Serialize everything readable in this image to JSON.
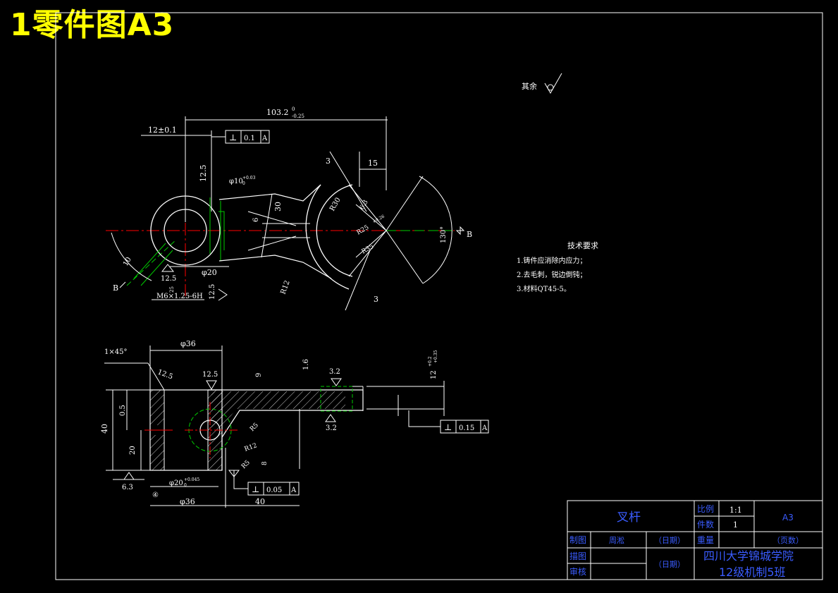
{
  "page_title": "1零件图A3",
  "roughness_note": "其余",
  "tech_requirements": {
    "title": "技术要求",
    "items": [
      "1.铸件应消除内应力；",
      "2.去毛刺，锐边倒钝；",
      "3.材料QT45-5。"
    ]
  },
  "dims": {
    "d103": "103.2",
    "d103_tol": "0",
    "d103_tol2": "-0.25",
    "d12": "12±0.1",
    "perp_sym": "⊥",
    "tol_01": "0.1",
    "datum_A": "A",
    "d15": "15",
    "d3_top": "3",
    "d3_bot": "3",
    "d12_5_top": "12.5",
    "phi10": "φ10",
    "phi10_tol": "+0.03",
    "phi10_tol2": "0",
    "d30": "30",
    "d6": "6",
    "R30": "R30",
    "R25": "R25",
    "R35": "R35",
    "R12": "R12",
    "d6_3": "6.3",
    "r_tol": "+0.26",
    "angle130": "130°",
    "section_B_right": "B",
    "section_B_left": "B",
    "d10_left": "10",
    "d12_5_left": "12.5",
    "phi20_top": "φ20",
    "d12_5_bottom": "12.5",
    "thread": "M6×1.25-6H",
    "d25": "25",
    "chamfer": "1×45°",
    "phi36_top": "φ36",
    "d12_5_sec1": "12.5",
    "d12_5_sec2": "12.5",
    "d9": "9",
    "d1_6": "1.6",
    "d3_2_top": "3.2",
    "d3_2_bot": "3.2",
    "d12_right": "12",
    "d12_right_tol": "+0.2",
    "d12_right_tol2": "+0.35",
    "tol_015": "0.15",
    "d40_left": "40",
    "d0_5": "0.5",
    "d20": "20",
    "d6_3_bottom": "6.3",
    "phi20_bot": "φ20",
    "phi20_bot_tol": "+0.045",
    "phi20_bot_tol2": "0",
    "phi36_bot": "φ36",
    "d40_bottom": "40",
    "tol_005": "0.05",
    "R5_a": "R5",
    "R12_b": "R12",
    "R5_b": "R5",
    "d8": "8",
    "phi_sym_mark": "④"
  },
  "title_block": {
    "part_name": "叉杆",
    "scale_label": "比例",
    "scale_value": "1:1",
    "qty_label": "件数",
    "qty_value": "1",
    "sheet_size": "A3",
    "drawn_label": "制图",
    "drawn_name": "周淞",
    "date_label_1": "（日期）",
    "page_label": "（页数）",
    "weight_label": "重量",
    "draft_label": "描图",
    "review_label": "审核",
    "date_label_2": "（日期）",
    "school": "四川大学锦城学院",
    "class_name": "12级机制5班"
  }
}
